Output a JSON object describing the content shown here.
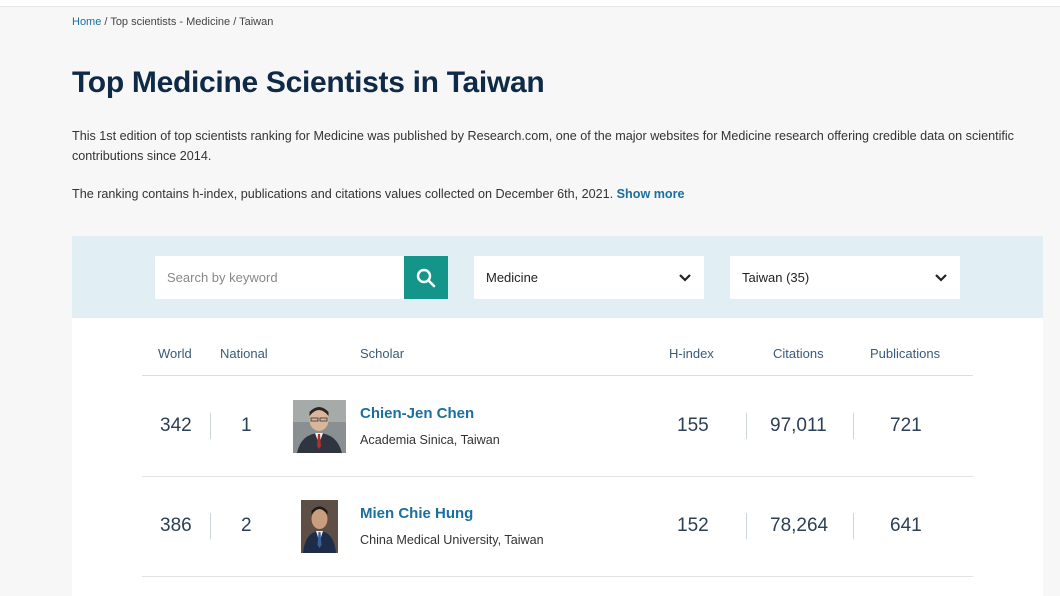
{
  "breadcrumb": {
    "home": "Home",
    "rest": " / Top scientists - Medicine / Taiwan"
  },
  "title": "Top Medicine Scientists in Taiwan",
  "description": {
    "p1": "This 1st edition of top scientists ranking for Medicine was published by Research.com, one of the major websites for Medicine research offering credible data on scientific contributions since 2014.",
    "p2": "The ranking contains h-index, publications and citations values collected on December 6th, 2021.",
    "show_more": "Show more"
  },
  "filters": {
    "search_placeholder": "Search by keyword",
    "discipline": "Medicine",
    "country": "Taiwan (35)"
  },
  "table": {
    "headers": {
      "world": "World",
      "national": "National",
      "scholar": "Scholar",
      "hindex": "H-index",
      "citations": "Citations",
      "publications": "Publications"
    },
    "rows": [
      {
        "world": "342",
        "national": "1",
        "name": "Chien-Jen Chen",
        "affiliation": "Academia Sinica, Taiwan",
        "hindex": "155",
        "citations": "97,011",
        "publications": "721"
      },
      {
        "world": "386",
        "national": "2",
        "name": "Mien Chie Hung",
        "affiliation": "China Medical University, Taiwan",
        "hindex": "152",
        "citations": "78,264",
        "publications": "641"
      }
    ]
  },
  "colors": {
    "accent": "#14958a",
    "link": "#1a6fa0",
    "title": "#0e2a47",
    "filter_bg": "#e1eff4"
  },
  "icons": {
    "search": "search-icon",
    "dropdown": "chevron-down-icon"
  }
}
